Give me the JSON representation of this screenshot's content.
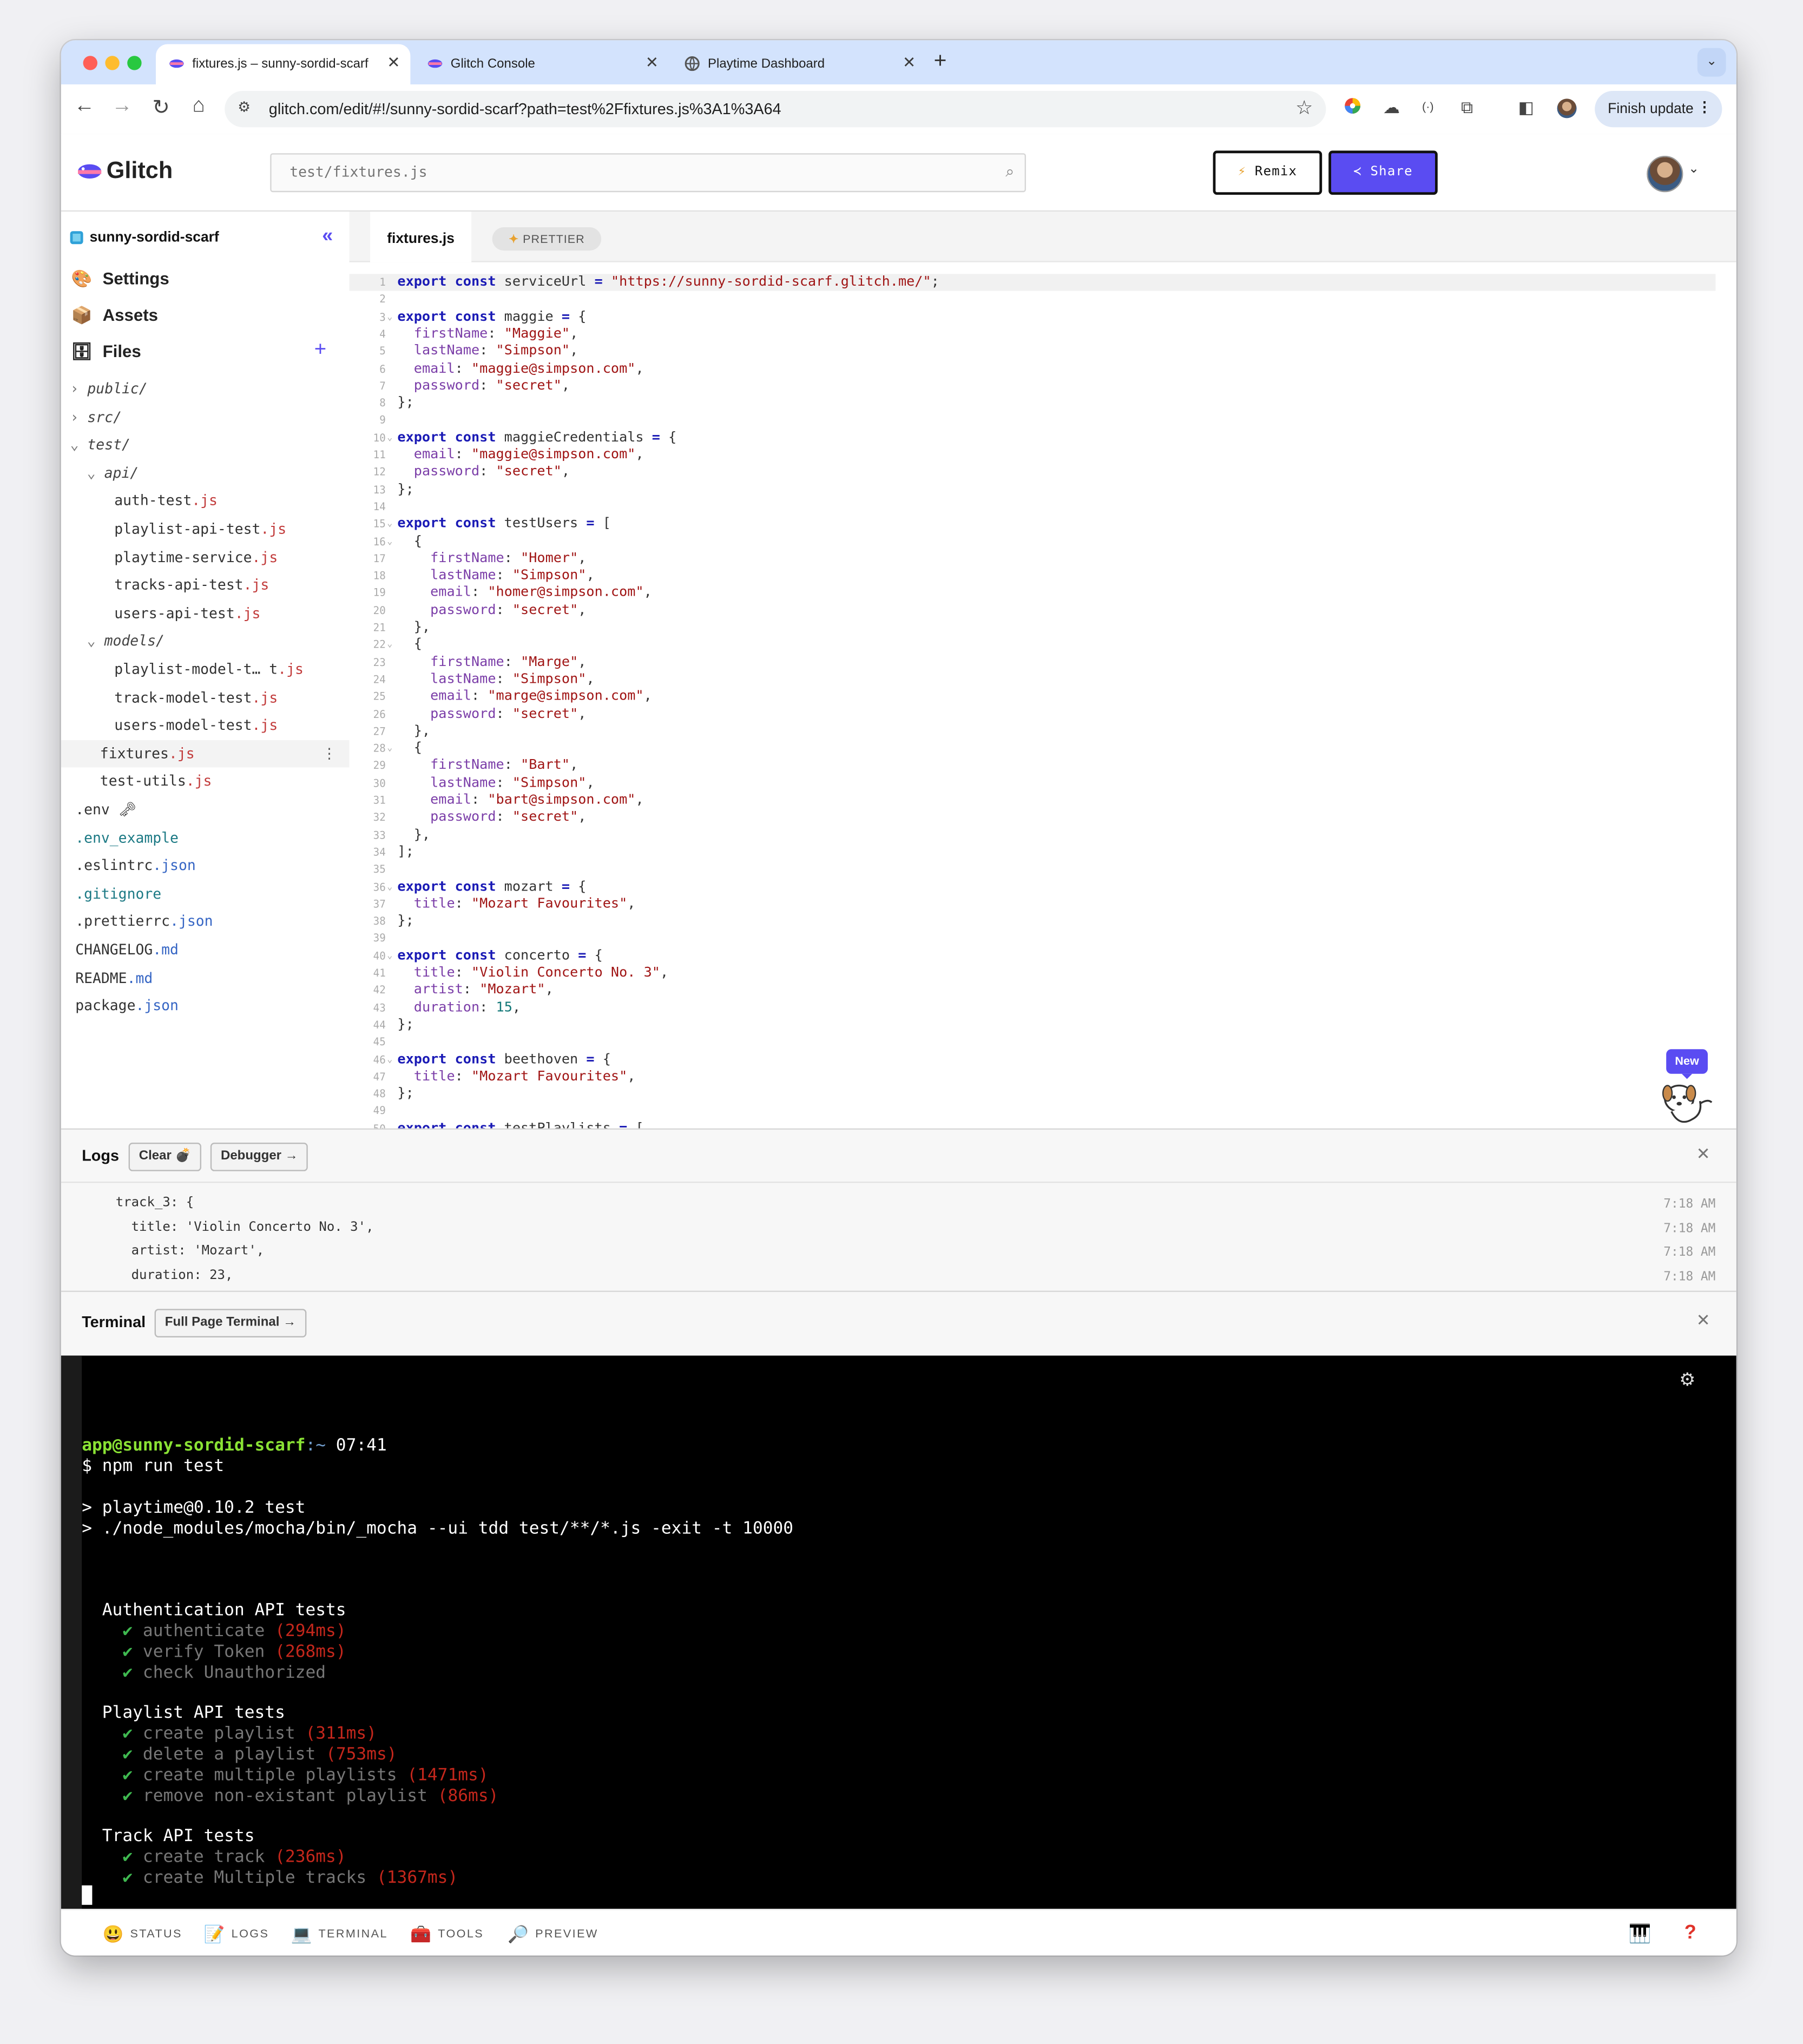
{
  "browser": {
    "tabs": [
      {
        "title": "fixtures.js – sunny-sordid-scarf",
        "favicon": "glitch-fish-icon",
        "active": true
      },
      {
        "title": "Glitch Console",
        "favicon": "glitch-fish-icon",
        "active": false
      },
      {
        "title": "Playtime Dashboard",
        "favicon": "globe-icon",
        "active": false
      }
    ],
    "url": "glitch.com/edit/#!/sunny-sordid-scarf?path=test%2Ffixtures.js%3A1%3A64",
    "finish_update_label": "Finish update"
  },
  "header": {
    "logo_text": "Glitch",
    "search_placeholder": "test/fixtures.js",
    "remix_label": "Remix",
    "share_label": "Share"
  },
  "sidebar": {
    "project_name": "sunny-sordid-scarf",
    "sections": [
      {
        "label": "Settings",
        "icon": "palette-icon"
      },
      {
        "label": "Assets",
        "icon": "box-icon"
      },
      {
        "label": "Files",
        "icon": "cabinet-icon"
      }
    ],
    "tree": [
      {
        "kind": "dir",
        "name": "public/",
        "ext": "",
        "depth": 0,
        "open": false
      },
      {
        "kind": "dir",
        "name": "src/",
        "ext": "",
        "depth": 0,
        "open": false
      },
      {
        "kind": "dir",
        "name": "test/",
        "ext": "",
        "depth": 0,
        "open": true
      },
      {
        "kind": "dir",
        "name": "api/",
        "ext": "",
        "depth": 1,
        "open": true
      },
      {
        "kind": "file",
        "name": "auth-test",
        "ext": ".js",
        "depth": 2
      },
      {
        "kind": "file",
        "name": "playlist-api-test",
        "ext": ".js",
        "depth": 2
      },
      {
        "kind": "file",
        "name": "playtime-service",
        "ext": ".js",
        "depth": 2
      },
      {
        "kind": "file",
        "name": "tracks-api-test",
        "ext": ".js",
        "depth": 2
      },
      {
        "kind": "file",
        "name": "users-api-test",
        "ext": ".js",
        "depth": 2
      },
      {
        "kind": "dir",
        "name": "models/",
        "ext": "",
        "depth": 1,
        "open": true
      },
      {
        "kind": "file",
        "name": "playlist-model-t… t",
        "ext": ".js",
        "depth": 2
      },
      {
        "kind": "file",
        "name": "track-model-test",
        "ext": ".js",
        "depth": 2
      },
      {
        "kind": "file",
        "name": "users-model-test",
        "ext": ".js",
        "depth": 2
      },
      {
        "kind": "file",
        "name": "fixtures",
        "ext": ".js",
        "depth": 1,
        "selected": true
      },
      {
        "kind": "file",
        "name": "test-utils",
        "ext": ".js",
        "depth": 1
      },
      {
        "kind": "file",
        "name": ".env 🗝",
        "ext": "",
        "depth": -1
      },
      {
        "kind": "file",
        "name": ".env_example",
        "ext": "",
        "depth": -1,
        "color": "teal"
      },
      {
        "kind": "file",
        "name": ".eslintrc",
        "ext": ".json",
        "depth": -1
      },
      {
        "kind": "file",
        "name": ".gitignore",
        "ext": "",
        "depth": -1,
        "color": "teal"
      },
      {
        "kind": "file",
        "name": ".prettierrc",
        "ext": ".json",
        "depth": -1
      },
      {
        "kind": "file",
        "name": "CHANGELOG",
        "ext": ".md",
        "depth": -1
      },
      {
        "kind": "file",
        "name": "README",
        "ext": ".md",
        "depth": -1
      },
      {
        "kind": "file",
        "name": "package",
        "ext": ".json",
        "depth": -1
      }
    ]
  },
  "editor": {
    "active_tab": "fixtures.js",
    "prettier_label": "PRETTIER",
    "lines": [
      "export const serviceUrl = \"https://sunny-sordid-scarf.glitch.me/\";",
      "",
      "export const maggie = {",
      "  firstName: \"Maggie\",",
      "  lastName: \"Simpson\",",
      "  email: \"maggie@simpson.com\",",
      "  password: \"secret\",",
      "};",
      "",
      "export const maggieCredentials = {",
      "  email: \"maggie@simpson.com\",",
      "  password: \"secret\",",
      "};",
      "",
      "export const testUsers = [",
      "  {",
      "    firstName: \"Homer\",",
      "    lastName: \"Simpson\",",
      "    email: \"homer@simpson.com\",",
      "    password: \"secret\",",
      "  },",
      "  {",
      "    firstName: \"Marge\",",
      "    lastName: \"Simpson\",",
      "    email: \"marge@simpson.com\",",
      "    password: \"secret\",",
      "  },",
      "  {",
      "    firstName: \"Bart\",",
      "    lastName: \"Simpson\",",
      "    email: \"bart@simpson.com\",",
      "    password: \"secret\",",
      "  },",
      "];",
      "",
      "export const mozart = {",
      "  title: \"Mozart Favourites\",",
      "};",
      "",
      "export const concerto = {",
      "  title: \"Violin Concerto No. 3\",",
      "  artist: \"Mozart\",",
      "  duration: 15,",
      "};",
      "",
      "export const beethoven = {",
      "  title: \"Mozart Favourites\",",
      "};",
      "",
      "export const testPlaylists = ["
    ],
    "fold_lines": [
      3,
      10,
      15,
      16,
      22,
      28,
      36,
      40,
      46
    ],
    "new_badge": "New"
  },
  "logs": {
    "title": "Logs",
    "clear_label": "Clear",
    "debugger_label": "Debugger →",
    "entries": [
      {
        "text": "  track_3: {",
        "time": "7:18 AM"
      },
      {
        "text": "    title: 'Violin Concerto No. 3',",
        "time": "7:18 AM"
      },
      {
        "text": "    artist: 'Mozart',",
        "time": "7:18 AM"
      },
      {
        "text": "    duration: 23,",
        "time": "7:18 AM"
      }
    ]
  },
  "terminal": {
    "title": "Terminal",
    "full_page_label": "Full Page Terminal →",
    "prompt_user": "app@sunny-sordid-scarf",
    "prompt_path": ":~",
    "prompt_time": " 07:41",
    "command": "$ npm run test",
    "script_line_1": "> playtime@0.10.2 test",
    "script_line_2": "> ./node_modules/mocha/bin/_mocha --ui tdd test/**/*.js -exit -t 10000",
    "suites": [
      {
        "name": "Authentication API tests",
        "tests": [
          {
            "name": "authenticate",
            "time": "(294ms)"
          },
          {
            "name": "verify Token",
            "time": "(268ms)"
          },
          {
            "name": "check Unauthorized",
            "time": ""
          }
        ]
      },
      {
        "name": "Playlist API tests",
        "tests": [
          {
            "name": "create playlist",
            "time": "(311ms)"
          },
          {
            "name": "delete a playlist",
            "time": "(753ms)"
          },
          {
            "name": "create multiple playlists",
            "time": "(1471ms)"
          },
          {
            "name": "remove non-existant playlist",
            "time": "(86ms)"
          }
        ]
      },
      {
        "name": "Track API tests",
        "tests": [
          {
            "name": "create track",
            "time": "(236ms)"
          },
          {
            "name": "create Multiple tracks",
            "time": "(1367ms)"
          }
        ]
      }
    ]
  },
  "statusbar": {
    "items": [
      {
        "label": "STATUS",
        "icon": "smiley-icon"
      },
      {
        "label": "LOGS",
        "icon": "memo-icon"
      },
      {
        "label": "TERMINAL",
        "icon": "laptop-icon"
      },
      {
        "label": "TOOLS",
        "icon": "toolbox-icon"
      },
      {
        "label": "PREVIEW",
        "icon": "magnifier-icon"
      }
    ],
    "help": "?"
  }
}
